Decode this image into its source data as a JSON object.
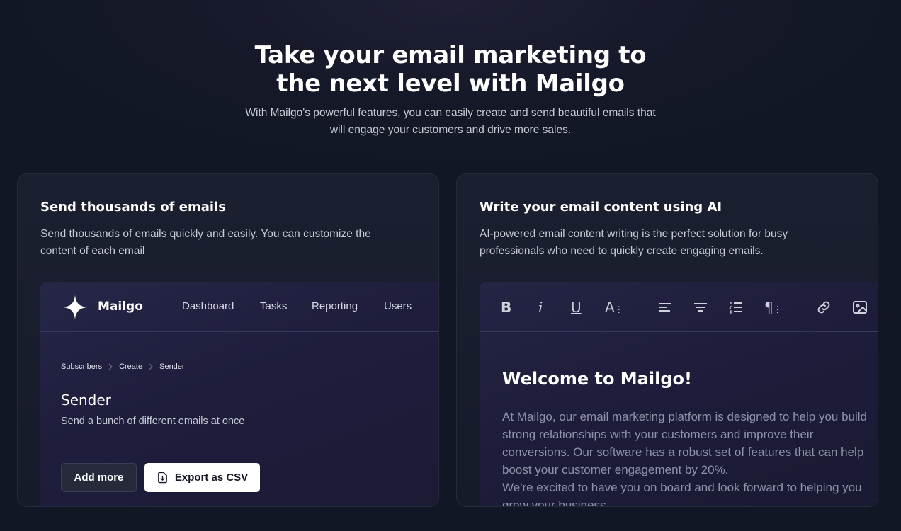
{
  "hero": {
    "title": "Take your email marketing to the next level with Mailgo",
    "subtitle": "With Mailgo's powerful features, you can easily create and send beautiful emails that will engage your customers and drive more sales."
  },
  "cards": {
    "left": {
      "title": "Send thousands of emails",
      "description": "Send thousands of emails quickly and easily. You can customize the content of each email",
      "mock": {
        "brand": "Mailgo",
        "nav": [
          "Dashboard",
          "Tasks",
          "Reporting",
          "Users"
        ],
        "breadcrumbs": [
          "Subscribers",
          "Create",
          "Sender"
        ],
        "page_title": "Sender",
        "page_subtitle": "Send a bunch of different emails at once",
        "add_button": "Add more",
        "export_button": "Export as CSV"
      }
    },
    "right": {
      "title": "Write your email content using AI",
      "description": "AI-powered email content writing is the perfect solution for busy professionals who need to quickly create engaging emails.",
      "editor": {
        "toolbar": [
          "bold-icon",
          "italic-icon",
          "underline-icon",
          "text-size-icon",
          "align-left-icon",
          "align-center-icon",
          "numbered-list-icon",
          "paragraph-icon",
          "link-icon",
          "image-icon"
        ],
        "heading": "Welcome to Mailgo!",
        "body": "At Mailgo, our email marketing platform is designed to help you build strong relationships with your customers and improve their conversions. Our software has a robust set of features that can help boost your customer engagement by 20%.",
        "body2": "We're excited to have you on board and look forward to helping you grow your business."
      }
    }
  },
  "colors": {
    "background": "#141827",
    "card": "#1a1f2e",
    "mock": "#23233f",
    "muted_text": "#8f93a8"
  }
}
